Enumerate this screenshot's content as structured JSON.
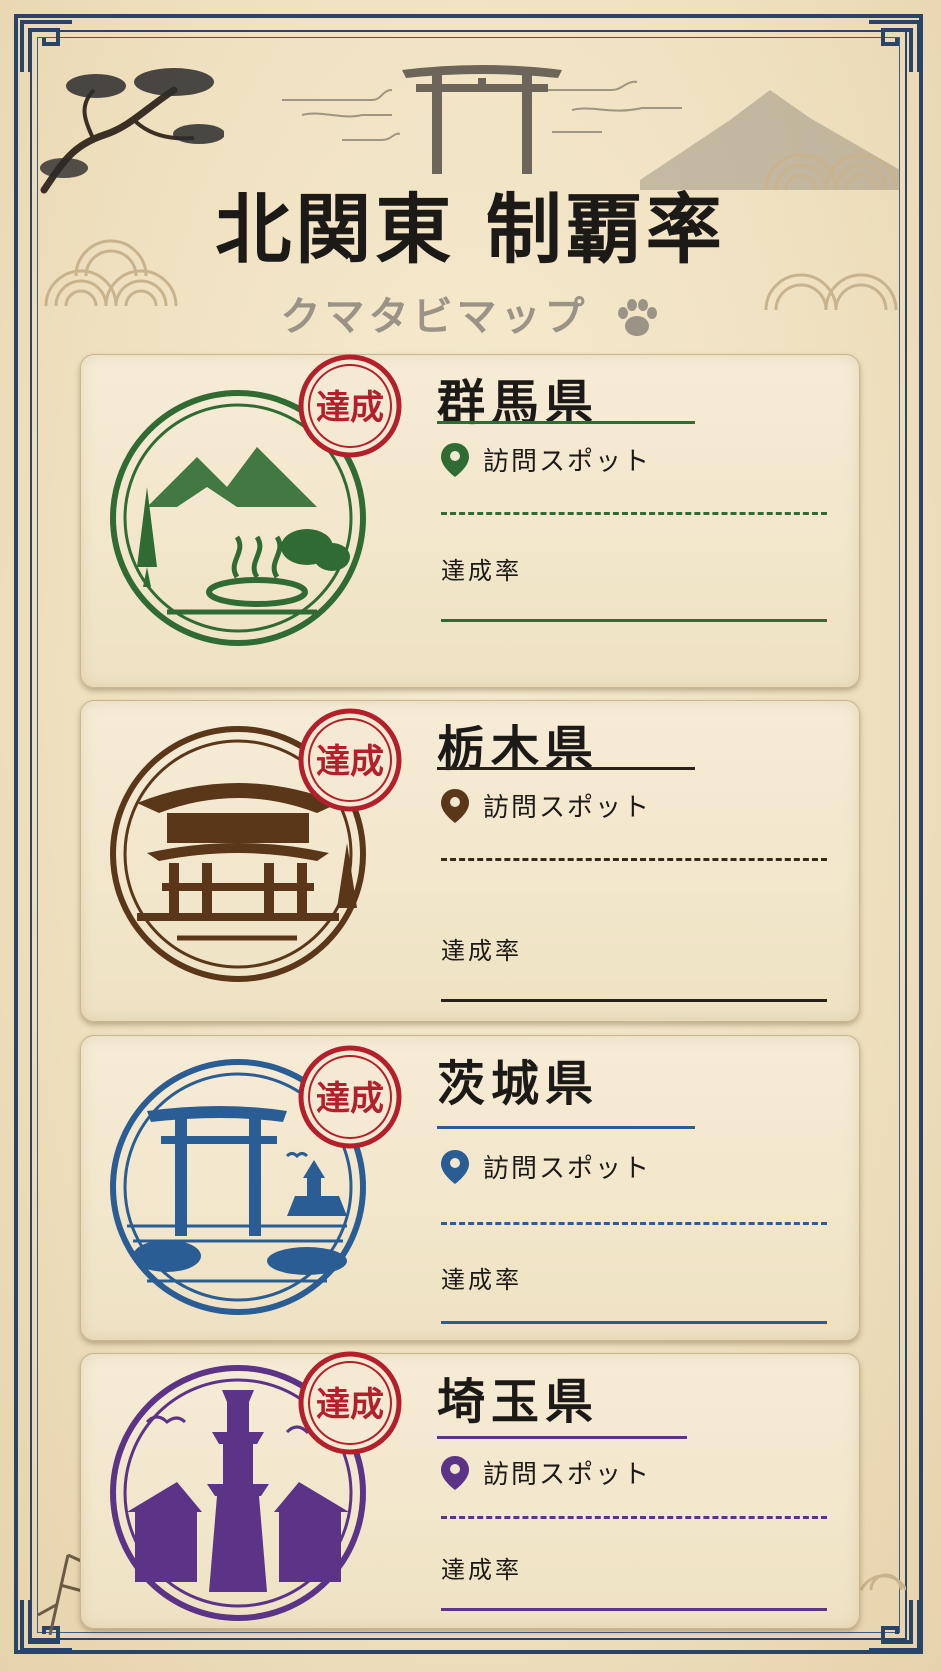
{
  "header": {
    "title": "北関東 制覇率",
    "subtitle": "クマタビマップ"
  },
  "cards": [
    {
      "prefecture": "群馬県",
      "spot_label": "訪問スポット",
      "rate_label": "達成率",
      "badge": "達成",
      "color": "#2f6b32",
      "stamp_icon": "mountain-onsen-stamp-icon"
    },
    {
      "prefecture": "栃木県",
      "spot_label": "訪問スポット",
      "rate_label": "達成率",
      "badge": "達成",
      "color": "#5a3718",
      "stamp_icon": "shrine-gate-stamp-icon"
    },
    {
      "prefecture": "茨城県",
      "spot_label": "訪問スポット",
      "rate_label": "達成率",
      "badge": "達成",
      "color": "#2a5d93",
      "stamp_icon": "torii-sea-stamp-icon"
    },
    {
      "prefecture": "埼玉県",
      "spot_label": "訪問スポット",
      "rate_label": "達成率",
      "badge": "達成",
      "color": "#5b3387",
      "stamp_icon": "bell-tower-stamp-icon"
    }
  ],
  "badge_color": "#b3202b",
  "frame_color": "#2a4468"
}
